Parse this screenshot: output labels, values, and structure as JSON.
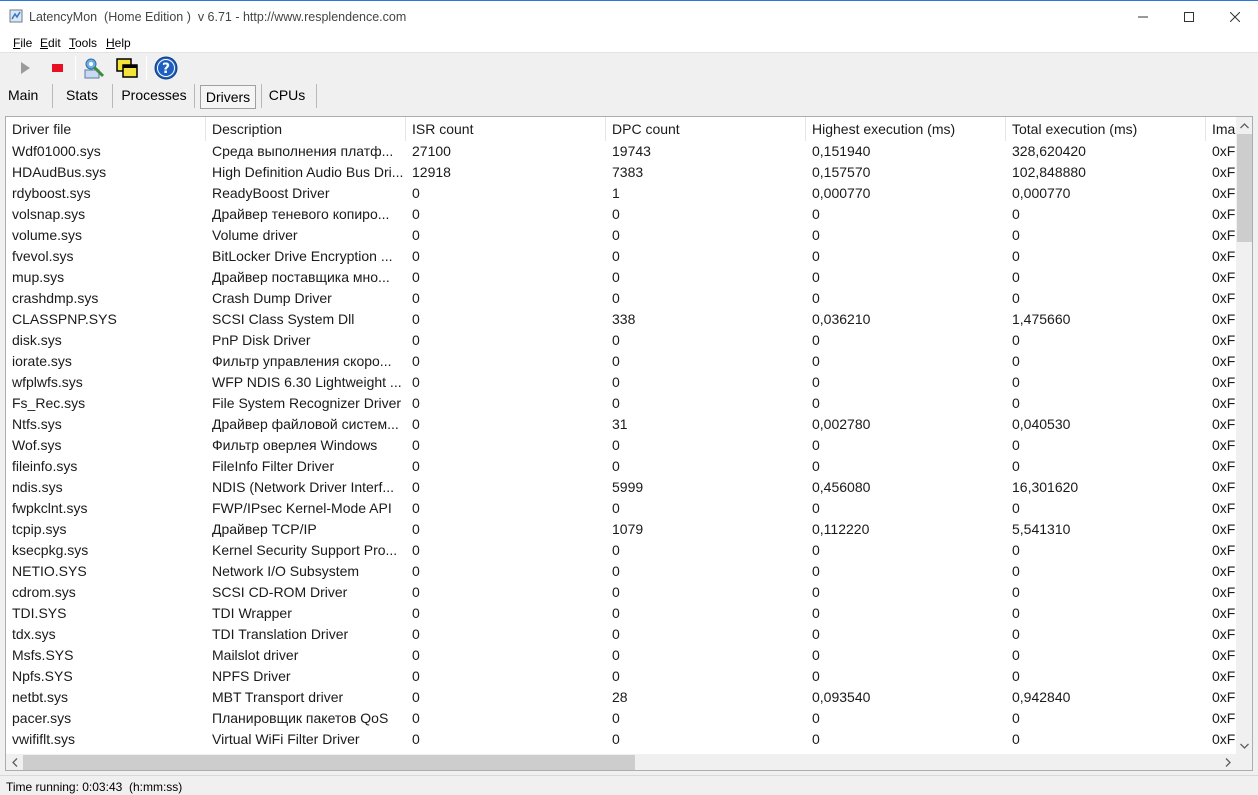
{
  "window": {
    "title": "LatencyMon  (Home Edition )  v 6.71 - http://www.resplendence.com"
  },
  "menu": {
    "file": {
      "accel": "F",
      "rest": "ile"
    },
    "edit": {
      "accel": "E",
      "rest": "dit"
    },
    "tools": {
      "accel": "T",
      "rest": "ools"
    },
    "help": {
      "accel": "H",
      "rest": "elp"
    }
  },
  "toolbar": {
    "icons": [
      "play-icon",
      "stop-icon",
      "kernel-wizard-icon",
      "windows-icon",
      "help-icon"
    ]
  },
  "tabs": [
    {
      "label": "Main"
    },
    {
      "label": "Stats"
    },
    {
      "label": "Processes"
    },
    {
      "label": "Drivers",
      "selected": true
    },
    {
      "label": "CPUs"
    }
  ],
  "table": {
    "columns": [
      "Driver file",
      "Description",
      "ISR count",
      "DPC count",
      "Highest execution (ms)",
      "Total execution (ms)",
      "Ima"
    ],
    "rows": [
      [
        "Wdf01000.sys",
        "Среда выполнения платф...",
        "27100",
        "19743",
        "0,151940",
        "328,620420",
        "0xF"
      ],
      [
        "HDAudBus.sys",
        "High Definition Audio Bus Dri...",
        "12918",
        "7383",
        "0,157570",
        "102,848880",
        "0xF"
      ],
      [
        "rdyboost.sys",
        "ReadyBoost Driver",
        "0",
        "1",
        "0,000770",
        "0,000770",
        "0xF"
      ],
      [
        "volsnap.sys",
        "Драйвер теневого копиро...",
        "0",
        "0",
        "0",
        "0",
        "0xF"
      ],
      [
        "volume.sys",
        "Volume driver",
        "0",
        "0",
        "0",
        "0",
        "0xF"
      ],
      [
        "fvevol.sys",
        "BitLocker Drive Encryption ...",
        "0",
        "0",
        "0",
        "0",
        "0xF"
      ],
      [
        "mup.sys",
        "Драйвер поставщика мно...",
        "0",
        "0",
        "0",
        "0",
        "0xF"
      ],
      [
        "crashdmp.sys",
        "Crash Dump Driver",
        "0",
        "0",
        "0",
        "0",
        "0xF"
      ],
      [
        "CLASSPNP.SYS",
        "SCSI Class System Dll",
        "0",
        "338",
        "0,036210",
        "1,475660",
        "0xF"
      ],
      [
        "disk.sys",
        "PnP Disk Driver",
        "0",
        "0",
        "0",
        "0",
        "0xF"
      ],
      [
        "iorate.sys",
        "Фильтр управления скоро...",
        "0",
        "0",
        "0",
        "0",
        "0xF"
      ],
      [
        "wfplwfs.sys",
        "WFP NDIS 6.30 Lightweight ...",
        "0",
        "0",
        "0",
        "0",
        "0xF"
      ],
      [
        "Fs_Rec.sys",
        "File System Recognizer Driver",
        "0",
        "0",
        "0",
        "0",
        "0xF"
      ],
      [
        "Ntfs.sys",
        "Драйвер файловой систем...",
        "0",
        "31",
        "0,002780",
        "0,040530",
        "0xF"
      ],
      [
        "Wof.sys",
        "Фильтр оверлея Windows",
        "0",
        "0",
        "0",
        "0",
        "0xF"
      ],
      [
        "fileinfo.sys",
        "FileInfo Filter Driver",
        "0",
        "0",
        "0",
        "0",
        "0xF"
      ],
      [
        "ndis.sys",
        "NDIS (Network Driver Interf...",
        "0",
        "5999",
        "0,456080",
        "16,301620",
        "0xF"
      ],
      [
        "fwpkclnt.sys",
        "FWP/IPsec Kernel-Mode API",
        "0",
        "0",
        "0",
        "0",
        "0xF"
      ],
      [
        "tcpip.sys",
        "Драйвер TCP/IP",
        "0",
        "1079",
        "0,112220",
        "5,541310",
        "0xF"
      ],
      [
        "ksecpkg.sys",
        "Kernel Security Support Pro...",
        "0",
        "0",
        "0",
        "0",
        "0xF"
      ],
      [
        "NETIO.SYS",
        "Network I/O Subsystem",
        "0",
        "0",
        "0",
        "0",
        "0xF"
      ],
      [
        "cdrom.sys",
        "SCSI CD-ROM Driver",
        "0",
        "0",
        "0",
        "0",
        "0xF"
      ],
      [
        "TDI.SYS",
        "TDI Wrapper",
        "0",
        "0",
        "0",
        "0",
        "0xF"
      ],
      [
        "tdx.sys",
        "TDI Translation Driver",
        "0",
        "0",
        "0",
        "0",
        "0xF"
      ],
      [
        "Msfs.SYS",
        "Mailslot driver",
        "0",
        "0",
        "0",
        "0",
        "0xF"
      ],
      [
        "Npfs.SYS",
        "NPFS Driver",
        "0",
        "0",
        "0",
        "0",
        "0xF"
      ],
      [
        "netbt.sys",
        "MBT Transport driver",
        "0",
        "28",
        "0,093540",
        "0,942840",
        "0xF"
      ],
      [
        "pacer.sys",
        "Планировщик пакетов QoS",
        "0",
        "0",
        "0",
        "0",
        "0xF"
      ],
      [
        "vwififlt.sys",
        "Virtual WiFi Filter Driver",
        "0",
        "0",
        "0",
        "0",
        "0xF"
      ]
    ]
  },
  "status": {
    "text": "Time running: 0:03:43  (h:mm:ss)"
  },
  "colors": {
    "accent": "#2b78d8",
    "stop": "#e81123",
    "help": "#1e5fbf"
  }
}
